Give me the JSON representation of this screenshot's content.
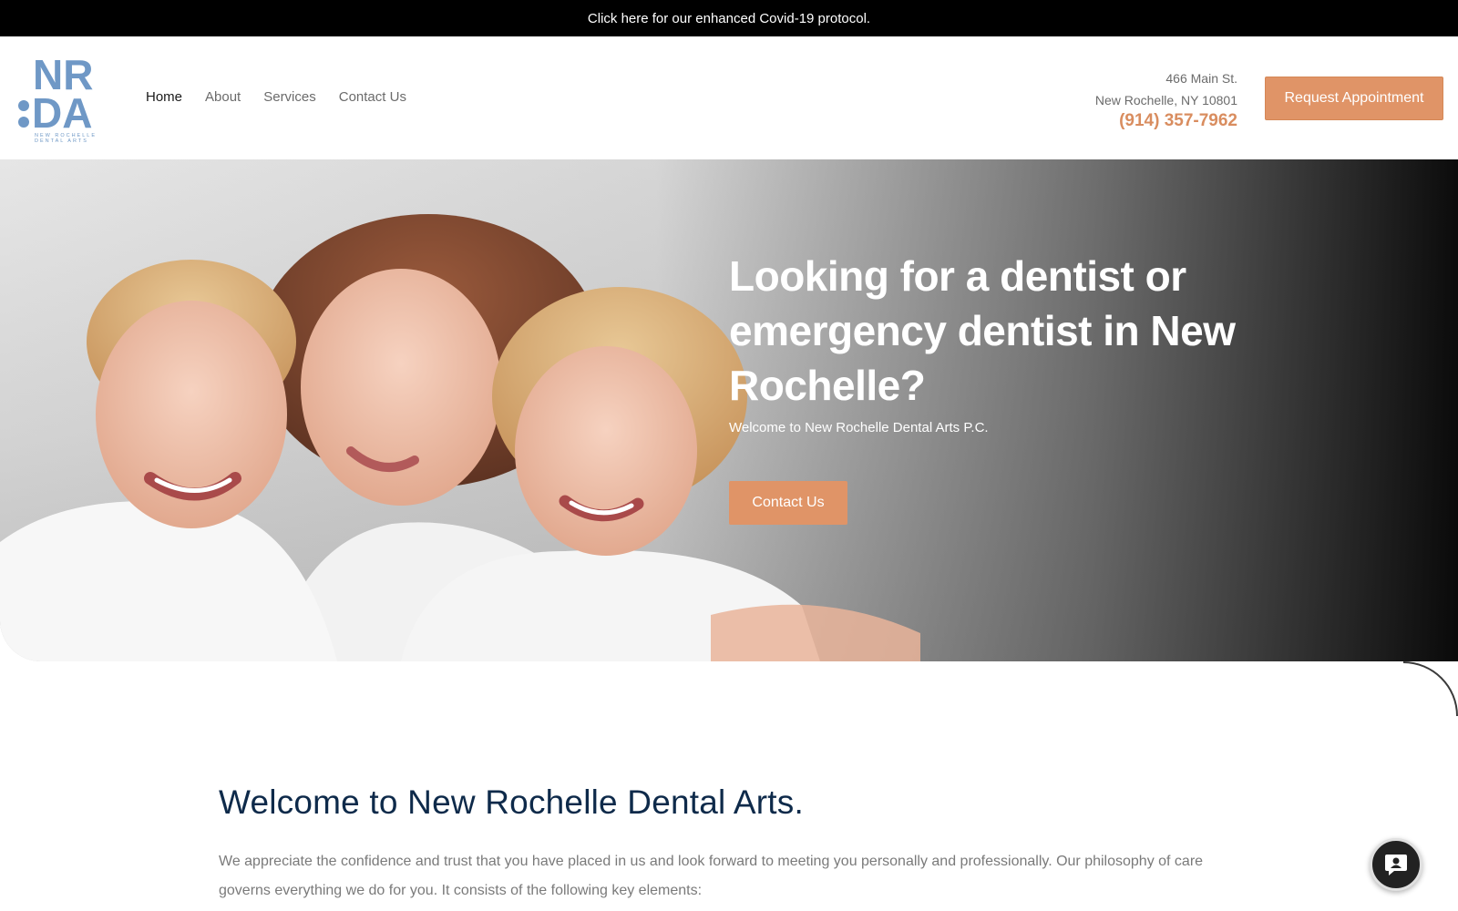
{
  "announcement": {
    "text": "Click here for our enhanced Covid-19 protocol."
  },
  "logo": {
    "top_letters": "NR",
    "bottom_letters": "DA",
    "tagline_line1": "NEW ROCHELLE",
    "tagline_line2": "DENTAL ARTS",
    "color": "#6f98c6"
  },
  "nav": {
    "items": [
      {
        "label": "Home",
        "active": true
      },
      {
        "label": "About",
        "active": false
      },
      {
        "label": "Services",
        "active": false
      },
      {
        "label": "Contact Us",
        "active": false
      }
    ]
  },
  "contact": {
    "street": "466 Main St.",
    "city": "New Rochelle, NY 10801",
    "phone": "(914) 357-7962"
  },
  "header": {
    "request_button": "Request Appointment"
  },
  "hero": {
    "title": "Looking for a dentist or emergency dentist in New Rochelle?",
    "subtitle": "Welcome to New Rochelle Dental Arts P.C.",
    "button": "Contact Us"
  },
  "welcome": {
    "title": "Welcome to New Rochelle Dental Arts.",
    "text": "We appreciate the confidence and trust that you have placed in us and look forward to meeting you personally and professionally. Our philosophy of care governs everything we do for you. It consists of the following key elements:"
  },
  "colors": {
    "accent": "#e09467",
    "navy": "#0e2a4a",
    "logo_blue": "#6f98c6"
  },
  "icons": {
    "chat": "chat-user-icon"
  }
}
